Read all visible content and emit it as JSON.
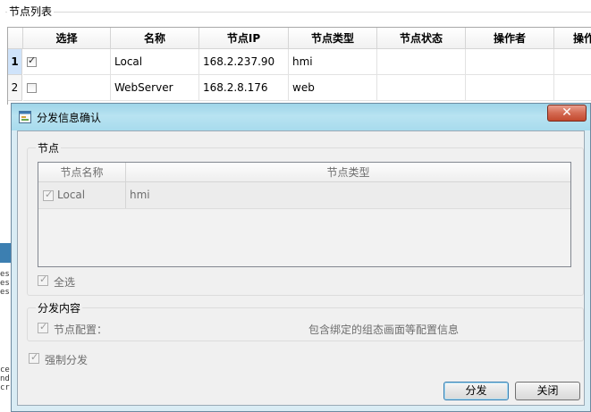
{
  "node_list": {
    "group_title": "节点列表",
    "columns": [
      "选择",
      "名称",
      "节点IP",
      "节点类型",
      "节点状态",
      "操作者",
      "操作"
    ],
    "rows": [
      {
        "row_num": "1",
        "checked": true,
        "name": "Local",
        "ip": "168.2.237.90",
        "type": "hmi",
        "status": "",
        "operator": ""
      },
      {
        "row_num": "2",
        "checked": false,
        "name": "WebServer",
        "ip": "168.2.8.176",
        "type": "web",
        "status": "",
        "operator": ""
      }
    ]
  },
  "left_strip": {
    "top_chars": [
      "es",
      "es",
      "es"
    ],
    "bottom_chars": [
      "ce",
      "nd",
      "cr"
    ]
  },
  "dialog": {
    "title": "分发信息确认",
    "close_glyph": "✕",
    "nodes_group": {
      "title": "节点",
      "columns": [
        "节点名称",
        "节点类型"
      ],
      "rows": [
        {
          "checked": true,
          "name": "Local",
          "type": "hmi"
        }
      ],
      "select_all_label": "全选",
      "select_all_checked": true
    },
    "content_group": {
      "title": "分发内容",
      "node_config_label": "节点配置：",
      "node_config_checked": true,
      "node_config_desc": "包含绑定的组态画面等配置信息"
    },
    "force_distribute_label": "强制分发",
    "force_distribute_checked": true,
    "distribute_button": "分发",
    "close_button": "关闭"
  },
  "colors": {
    "titlebar": "#a8dbed",
    "close_button": "#c2492e",
    "selected_row_header": "#cfe3fa",
    "disabled_text": "#6d6d6d"
  },
  "icons": {
    "dialog_icon": "dialog-app-icon",
    "check_mark": "✓"
  }
}
